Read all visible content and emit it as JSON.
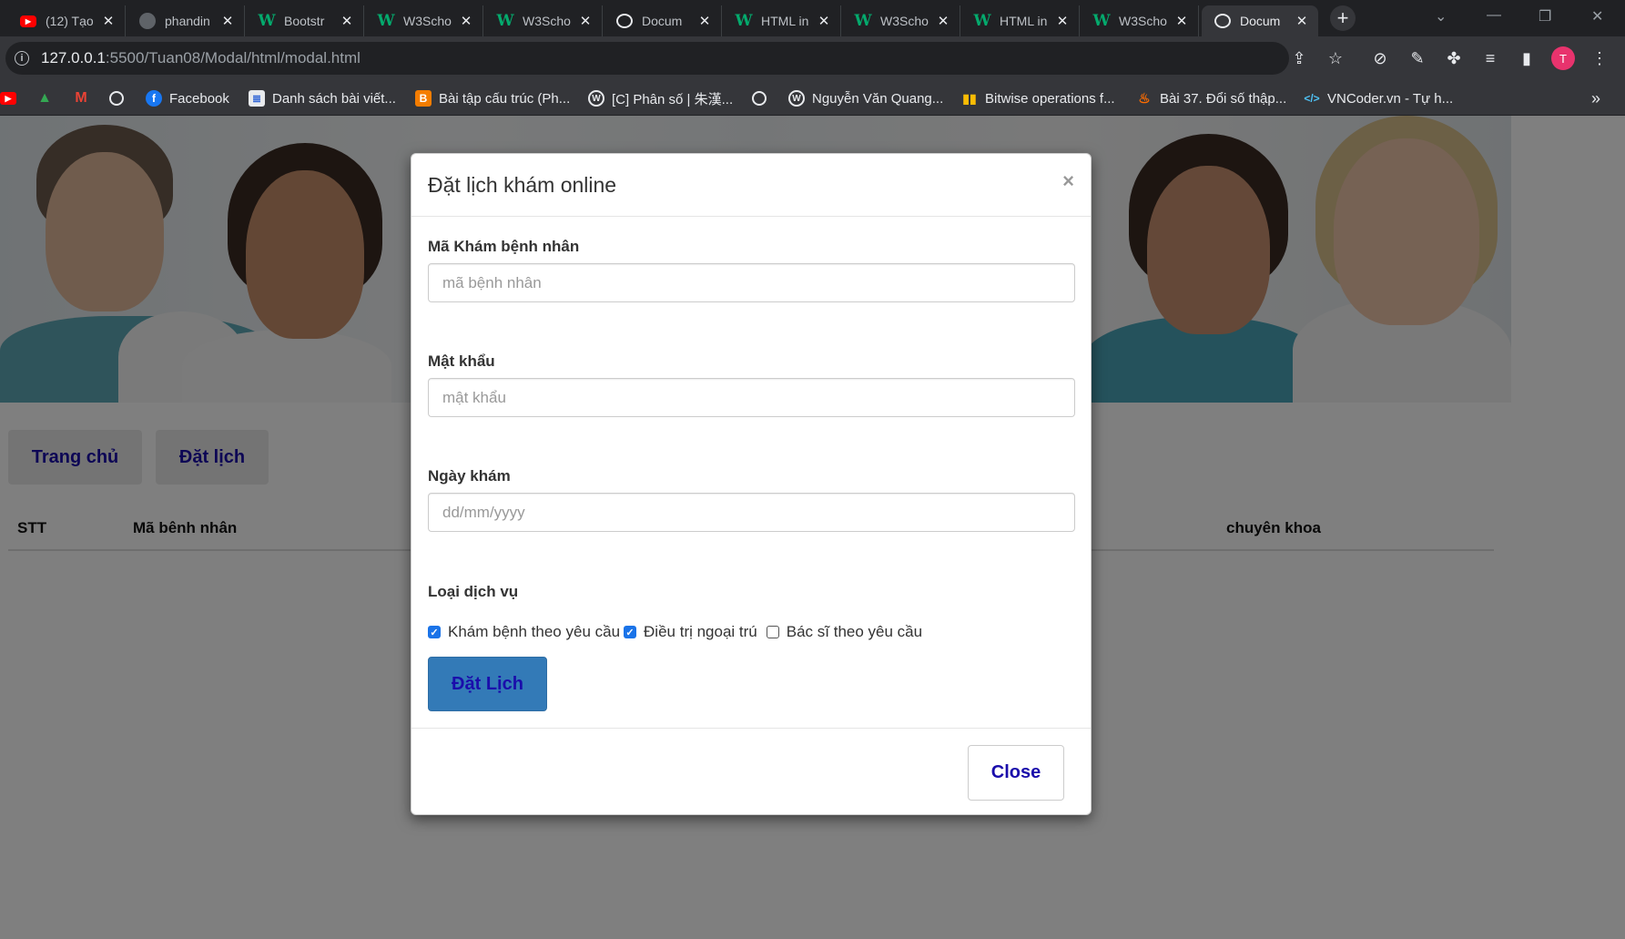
{
  "browser": {
    "tabs": [
      {
        "title": "(12) Tạo",
        "favicon": "youtube-icon"
      },
      {
        "title": "phandin",
        "favicon": "github-icon"
      },
      {
        "title": "Bootstr",
        "favicon": "w3schools-icon"
      },
      {
        "title": "W3Scho",
        "favicon": "w3schools-icon"
      },
      {
        "title": "W3Scho",
        "favicon": "w3schools-icon"
      },
      {
        "title": "Docum",
        "favicon": "globe-icon"
      },
      {
        "title": "HTML in",
        "favicon": "w3schools-icon"
      },
      {
        "title": "W3Scho",
        "favicon": "w3schools-icon"
      },
      {
        "title": "HTML in",
        "favicon": "w3schools-icon"
      },
      {
        "title": "W3Scho",
        "favicon": "w3schools-icon"
      },
      {
        "title": "Docum",
        "favicon": "globe-icon",
        "active": true
      }
    ],
    "new_tab_glyph": "+",
    "url_host": "127.0.0.1",
    "url_path": ":5500/Tuan08/Modal/html/modal.html",
    "profile_initial": "T",
    "bookmarks": [
      {
        "label": "",
        "icon": "youtube-icon"
      },
      {
        "label": "",
        "icon": "google-drive-icon"
      },
      {
        "label": "",
        "icon": "gmail-icon"
      },
      {
        "label": "",
        "icon": "globe-icon"
      },
      {
        "label": "Facebook",
        "icon": "facebook-icon"
      },
      {
        "label": "Danh sách bài viết...",
        "icon": "document-icon"
      },
      {
        "label": "Bài tập cấu trúc (Ph...",
        "icon": "blogger-icon"
      },
      {
        "label": "[C] Phân số | 朱漢...",
        "icon": "wordpress-icon"
      },
      {
        "label": "",
        "icon": "globe-icon"
      },
      {
        "label": "Nguyễn Văn Quang...",
        "icon": "wordpress-icon"
      },
      {
        "label": "Bitwise operations f...",
        "icon": "bar-chart-icon"
      },
      {
        "label": "Bài 37. Đổi số thập...",
        "icon": "fire-icon"
      },
      {
        "label": "VNCoder.vn - Tự h...",
        "icon": "code-icon"
      }
    ],
    "bookmarks_overflow": "»"
  },
  "page": {
    "nav": {
      "home": "Trang chủ",
      "booking": "Đặt lịch"
    },
    "table_headers": [
      "STT",
      "Mã bênh nhân",
      "chuyên khoa"
    ]
  },
  "modal": {
    "title": "Đặt lịch khám online",
    "close_x": "×",
    "patient_id": {
      "label": "Mã Khám bệnh nhân",
      "placeholder": "mã bệnh nhân"
    },
    "password": {
      "label": "Mật khẩu",
      "placeholder": "mật khẩu"
    },
    "date": {
      "label": "Ngày khám",
      "placeholder": "dd/mm/yyyy"
    },
    "service": {
      "label": "Loại dịch vụ",
      "options": [
        {
          "label": "Khám bệnh theo yêu cầu",
          "checked": true
        },
        {
          "label": "Điều trị ngoại trú",
          "checked": true
        },
        {
          "label": "Bác sĩ theo yêu cầu",
          "checked": false
        }
      ]
    },
    "submit_label": "Đặt Lịch",
    "close_label": "Close"
  },
  "colors": {
    "link_text": "#1a0dab",
    "primary_button": "#337ab7",
    "checkbox_checked": "#1a73e8",
    "profile": "#e8336d"
  }
}
